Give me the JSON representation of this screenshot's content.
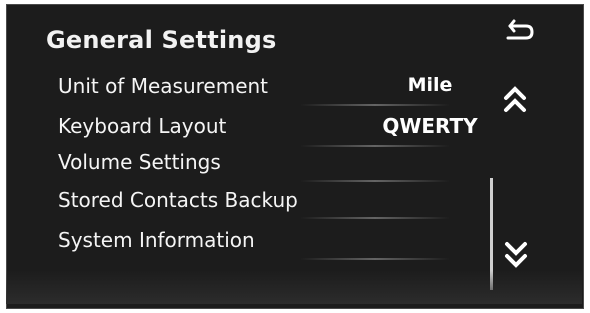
{
  "screen": {
    "title": "General Settings",
    "items": [
      {
        "label": "Unit of Measurement",
        "value": "Mile"
      },
      {
        "label": "Keyboard Layout",
        "value": "QWERTY"
      },
      {
        "label": "Volume Settings",
        "value": ""
      },
      {
        "label": "Stored Contacts Backup",
        "value": ""
      },
      {
        "label": "System Information",
        "value": ""
      }
    ],
    "icons": {
      "back": "back-arrow-icon",
      "scroll_up": "double-chevron-up-icon",
      "scroll_down": "double-chevron-down-icon"
    },
    "colors": {
      "background": "#1c1c1c",
      "text": "#f5f5f5",
      "border": "#4a4a4a"
    }
  }
}
